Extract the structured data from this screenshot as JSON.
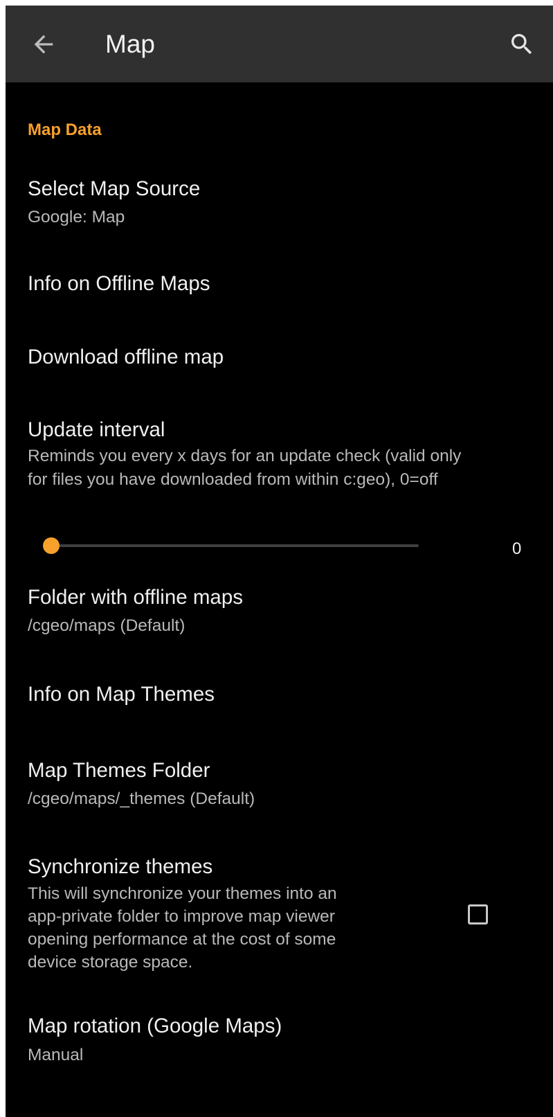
{
  "appbar": {
    "title": "Map",
    "back_icon": "arrow-left-icon",
    "search_icon": "search-icon"
  },
  "colors": {
    "accent": "#f7a12b",
    "appbar_bg": "#303030",
    "background": "#000000",
    "summary_text": "#b9b9b9"
  },
  "category": {
    "label": "Map Data"
  },
  "prefs": {
    "map_source": {
      "title": "Select Map Source",
      "summary": "Google: Map"
    },
    "info_offline": {
      "title": "Info on Offline Maps"
    },
    "download_offline": {
      "title": "Download offline map"
    },
    "update_interval": {
      "title": "Update interval",
      "summary_line1": "Reminds you every x days for an update check (valid only",
      "summary_line2": "for files you have downloaded from within c:geo), 0=off",
      "value": "0",
      "slider_fraction": 0
    },
    "offline_folder": {
      "title": "Folder with offline maps",
      "summary": "/cgeo/maps (Default)"
    },
    "info_themes": {
      "title": "Info on Map Themes"
    },
    "themes_folder": {
      "title": "Map Themes Folder",
      "summary": "/cgeo/maps/_themes (Default)"
    },
    "sync_themes": {
      "title": "Synchronize themes",
      "summary_line1": "This will synchronize your themes into an",
      "summary_line2": "app-private folder to improve map viewer",
      "summary_line3": "opening performance at the cost of some",
      "summary_line4": "device storage space.",
      "checked": false
    },
    "map_rotation": {
      "title": "Map rotation (Google Maps)",
      "summary": "Manual"
    }
  }
}
